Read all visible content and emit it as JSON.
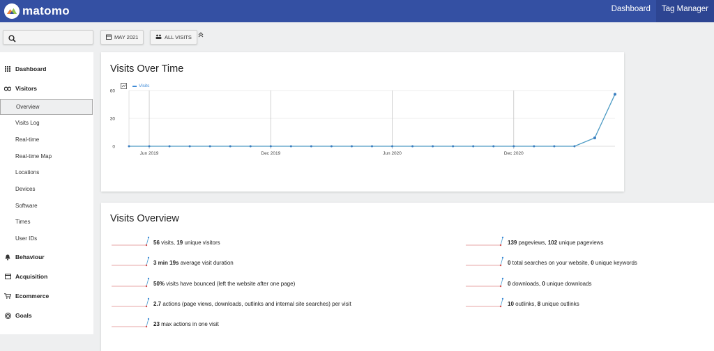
{
  "app": {
    "logo_text": "matomo"
  },
  "top_nav": [
    {
      "label": "Dashboard",
      "active": false
    },
    {
      "label": "Tag Manager",
      "active": true
    }
  ],
  "controls": {
    "period_label": "MAY 2021",
    "segment_label": "ALL VISITS"
  },
  "sidebar": {
    "groups": [
      {
        "label": "Dashboard",
        "icon": "dashboard-icon"
      },
      {
        "label": "Visitors",
        "icon": "visitors-icon"
      },
      {
        "label": "Behaviour",
        "icon": "behaviour-icon"
      },
      {
        "label": "Acquisition",
        "icon": "acquisition-icon"
      },
      {
        "label": "Ecommerce",
        "icon": "ecommerce-icon"
      },
      {
        "label": "Goals",
        "icon": "goals-icon"
      }
    ],
    "visitor_items": [
      "Overview",
      "Visits Log",
      "Real-time",
      "Real-time Map",
      "Locations",
      "Devices",
      "Software",
      "Times",
      "User IDs"
    ],
    "active_item": "Overview"
  },
  "visits_over_time": {
    "title": "Visits Over Time",
    "legend": "Visits",
    "colors": {
      "line": "#4d9bc4",
      "point": "#3a7ec0",
      "grid": "#d9d9d9"
    }
  },
  "chart_data": {
    "type": "line",
    "series": [
      {
        "name": "Visits",
        "values": [
          0,
          0,
          0,
          0,
          0,
          0,
          0,
          0,
          0,
          0,
          0,
          0,
          0,
          0,
          0,
          0,
          0,
          0,
          0,
          0,
          0,
          0,
          0,
          9,
          56
        ]
      }
    ],
    "x": [
      "2019-05",
      "2019-06",
      "2019-07",
      "2019-08",
      "2019-09",
      "2019-10",
      "2019-11",
      "2019-12",
      "2020-01",
      "2020-02",
      "2020-03",
      "2020-04",
      "2020-05",
      "2020-06",
      "2020-07",
      "2020-08",
      "2020-09",
      "2020-10",
      "2020-11",
      "2020-12",
      "2021-01",
      "2021-02",
      "2021-03",
      "2021-04",
      "2021-05"
    ],
    "x_tick_labels": [
      "Jun 2019",
      "Dec 2019",
      "Jun 2020",
      "Dec 2020"
    ],
    "y_ticks": [
      0,
      30,
      60
    ],
    "ylim": [
      0,
      60
    ],
    "grid": true,
    "legend_position": "top-left"
  },
  "visits_overview": {
    "title": "Visits Overview",
    "left": [
      {
        "bold1": "56",
        "text1": " visits, ",
        "bold2": "19",
        "text2": " unique visitors"
      },
      {
        "bold1": "3 min 19s",
        "text1": " average visit duration",
        "bold2": "",
        "text2": ""
      },
      {
        "bold1": "50%",
        "text1": " visits have bounced (left the website after one page)",
        "bold2": "",
        "text2": ""
      },
      {
        "bold1": "2.7",
        "text1": " actions (page views, downloads, outlinks and internal site searches) per visit",
        "bold2": "",
        "text2": ""
      },
      {
        "bold1": "23",
        "text1": " max actions in one visit",
        "bold2": "",
        "text2": ""
      }
    ],
    "right": [
      {
        "bold1": "139",
        "text1": " pageviews, ",
        "bold2": "102",
        "text2": " unique pageviews"
      },
      {
        "bold1": "0",
        "text1": " total searches on your website, ",
        "bold2": "0",
        "text2": " unique keywords"
      },
      {
        "bold1": "0",
        "text1": " downloads, ",
        "bold2": "0",
        "text2": " unique downloads"
      },
      {
        "bold1": "10",
        "text1": " outlinks, ",
        "bold2": "8",
        "text2": " unique outlinks"
      }
    ]
  }
}
